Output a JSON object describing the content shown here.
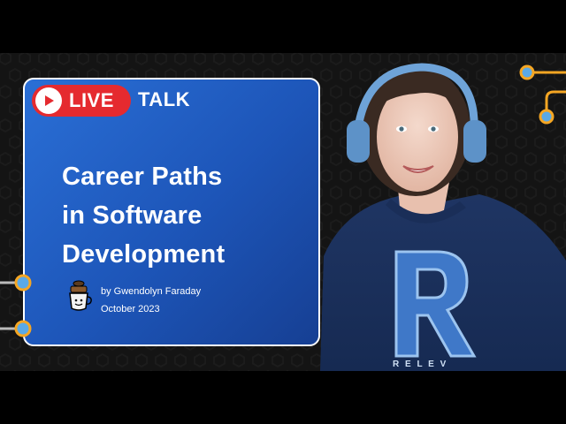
{
  "badge": {
    "live_label": "LIVE",
    "talk_label": "TALK",
    "play_icon": "play-icon",
    "color": "#e52a2f"
  },
  "card": {
    "title_lines": [
      "Career Paths",
      "in Software",
      "Development"
    ],
    "author": "by Gwendolyn Faraday",
    "date": "October 2023",
    "logo_icon": "coffee-mug-logo",
    "accent": "#2a6fd6"
  },
  "colors": {
    "background": "#000000",
    "hex_pattern": "#1c1c1c",
    "circuit": "#f5a623",
    "node": "#5aa9e6"
  }
}
